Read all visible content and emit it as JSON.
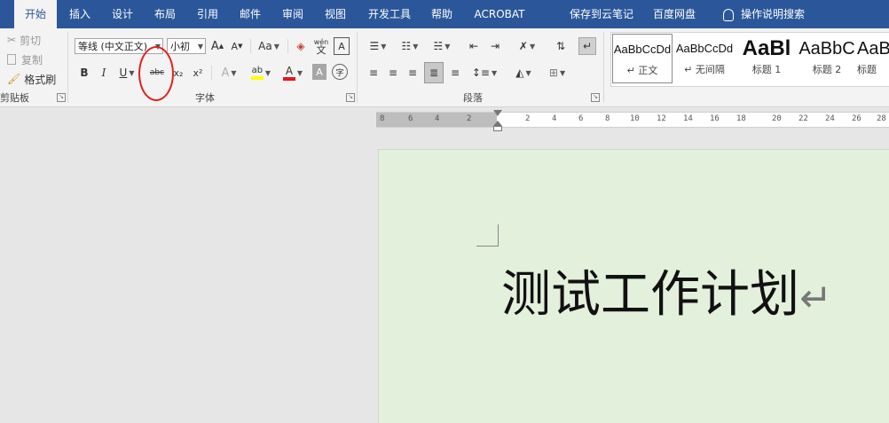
{
  "tabs": [
    {
      "label": "开始",
      "active": true
    },
    {
      "label": "插入"
    },
    {
      "label": "设计"
    },
    {
      "label": "布局"
    },
    {
      "label": "引用"
    },
    {
      "label": "邮件"
    },
    {
      "label": "审阅"
    },
    {
      "label": "视图"
    },
    {
      "label": "开发工具"
    },
    {
      "label": "帮助"
    },
    {
      "label": "ACROBAT"
    },
    {
      "label": "保存到云笔记"
    },
    {
      "label": "百度网盘"
    },
    {
      "label": "操作说明搜索"
    }
  ],
  "clipboard": {
    "cut": "剪切",
    "copy": "复制",
    "format_painter": "格式刷",
    "group_label": "剪贴板"
  },
  "font": {
    "font_name": "等线 (中文正文)",
    "font_size": "小初",
    "grow": "A",
    "shrink": "A",
    "case": "Aa",
    "phonetic": "wén",
    "border_char": "A",
    "bold": "B",
    "italic": "I",
    "underline": "U",
    "strikethrough": "abc",
    "subscript": "x₂",
    "superscript": "x²",
    "effects": "A",
    "highlight": "ab",
    "font_color": "A",
    "shading": "A",
    "enclose": "字",
    "group_label": "字体"
  },
  "paragraph": {
    "group_label": "段落"
  },
  "styles": [
    {
      "preview": "AaBbCcDd",
      "label": "正文"
    },
    {
      "preview": "AaBbCcDd",
      "label": "无间隔"
    },
    {
      "preview": "AaBl",
      "label": "标题 1"
    },
    {
      "preview": "AaBbC",
      "label": "标题 2"
    },
    {
      "preview": "AaB",
      "label": "标题"
    }
  ],
  "ruler": {
    "numbers": [
      "8",
      "6",
      "4",
      "2",
      "2",
      "4",
      "6",
      "8",
      "10",
      "12",
      "14",
      "16",
      "18",
      "20",
      "22",
      "24",
      "26",
      "28"
    ]
  },
  "document": {
    "title": "测试工作计划",
    "paragraph_mark": "↵"
  },
  "colors": {
    "accent": "#2b579a",
    "page_bg": "#e3f0dc",
    "annotation": "#e02020",
    "highlight": "#ffff00",
    "font_color": "#e81123"
  }
}
